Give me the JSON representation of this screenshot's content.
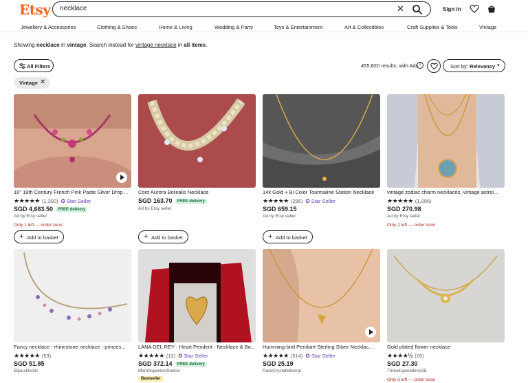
{
  "header": {
    "logo": "Etsy",
    "search_value": "necklace",
    "signin": "Sign in"
  },
  "categories": [
    "Jewellery & Accessories",
    "Clothing & Shoes",
    "Home & Living",
    "Wedding & Party",
    "Toys & Entertainment",
    "Art & Collectibles",
    "Craft Supplies & Tools",
    "Vintage"
  ],
  "notice": {
    "prefix": "Showing ",
    "term": "necklace",
    "middle": " in ",
    "scope": "vintage",
    "middle2": ". Search instead for ",
    "link": "vintage necklace",
    "middle3": " in ",
    "all": "all items",
    "suffix": "."
  },
  "filters": {
    "all_filters": "All Filters",
    "chip": "Vintage",
    "results": "455,820 results, with Ads",
    "sort_prefix": "Sort by: ",
    "sort_value": "Relevancy"
  },
  "colors": {
    "brand": "#F1641E",
    "star_seller": "#5f3cbf",
    "alert": "#b3261e"
  },
  "listings": [
    {
      "title": "16\" 19th Century French Pink Paste Silver Drop ...",
      "stars": "★★★★★",
      "count": "(1,300)",
      "star_seller": "Star Seller",
      "price": "SGD 4,683.50",
      "free": "FREE delivery",
      "ad": "Ad by Etsy seller",
      "note": "Only 1 left — order soon",
      "button": "Add to basket"
    },
    {
      "title": "Coro Aurora Borealis Necklace",
      "stars": "",
      "count": "",
      "star_seller": "",
      "price": "SGD 163.70",
      "free": "FREE delivery",
      "ad": "Ad by Etsy seller",
      "note": "",
      "button": "Add to basket"
    },
    {
      "title": "14k Gold + Bi Color Tourmaline Station Necklace",
      "stars": "★★★★★",
      "count": "(295)",
      "star_seller": "Star Seller",
      "price": "SGD 659.15",
      "free": "",
      "ad": "Ad by Etsy seller",
      "note": "",
      "button": "Add to basket"
    },
    {
      "title": "vintage zodiac charm necklaces, vintage astrol...",
      "stars": "★★★★★",
      "count": "(1,096)",
      "star_seller": "",
      "price": "SGD 270.98",
      "free": "",
      "ad": "Ad by Etsy seller",
      "note": "Only 2 left — order soon",
      "button": ""
    },
    {
      "title": "Fancy necklace - rhinestone necklace - princes...",
      "stars": "★★★★★",
      "count": "(53)",
      "star_seller": "",
      "price": "SGD 51.85",
      "free": "",
      "ad": "BijouxDeclic",
      "note": "",
      "button": ""
    },
    {
      "title": "LANA DEL REY - Heart Pendent - Necklace & Bo...",
      "stars": "★★★★★",
      "count": "(12)",
      "star_seller": "Star Seller",
      "price": "SGD 372.14",
      "free": "FREE delivery",
      "ad": "MambojamboStudios",
      "badge": "Bestseller",
      "note": "",
      "button": ""
    },
    {
      "title": "Humming-bird Pendant Sterling Silver Necklac...",
      "stars": "★★★★★",
      "count": "(514)",
      "star_seller": "Star Seller",
      "price": "SGD 25.19",
      "free": "",
      "ad": "RareCrystalMineral",
      "note": "",
      "button": ""
    },
    {
      "title": "Gold plated flower necklace",
      "stars": "★★★★½",
      "count": "(26)",
      "star_seller": "",
      "price": "SGD 27.30",
      "free": "",
      "ad": "TrinketsjewelleryGB",
      "note": "Only 3 left — order soon",
      "button": ""
    }
  ]
}
